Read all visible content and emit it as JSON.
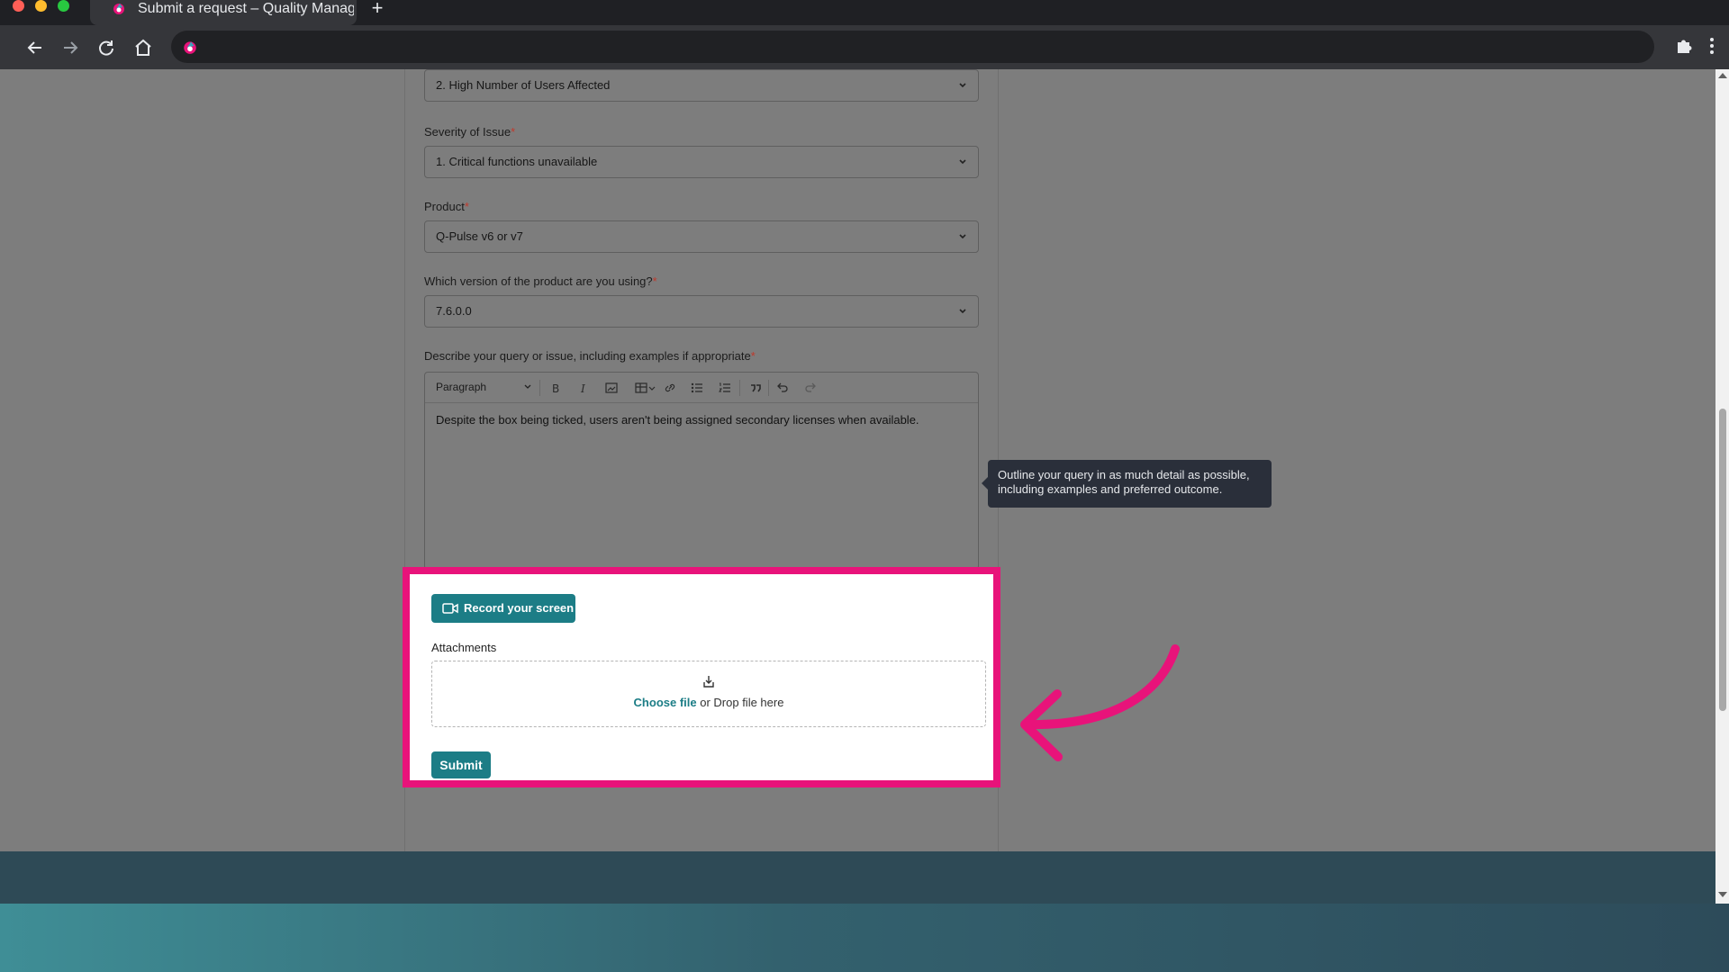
{
  "browser": {
    "tab_title": "Submit a request – Quality Manag",
    "new_tab_label": "+"
  },
  "form": {
    "fields": [
      {
        "label": "",
        "required": false,
        "value": "2. High Number of Users Affected"
      },
      {
        "label": "Severity of Issue",
        "required": true,
        "value": "1. Critical functions unavailable"
      },
      {
        "label": "Product",
        "required": true,
        "value": "Q-Pulse v6 or v7"
      },
      {
        "label": "Which version of the product are you using?",
        "required": true,
        "value": "7.6.0.0"
      }
    ],
    "description": {
      "label": "Describe your query or issue, including examples if appropriate",
      "required_mark": "*",
      "paragraph_style": "Paragraph",
      "text": "Despite the box being ticked, users aren't being assigned secondary licenses when available."
    },
    "tooltip": "Outline your query in as much detail as possible, including examples and preferred outcome.",
    "record_button": "Record your screen",
    "attachments_label": "Attachments",
    "dropzone": {
      "link": "Choose file",
      "text": " or Drop file here"
    },
    "submit_button": "Submit"
  },
  "colors": {
    "accent": "#1c7d86",
    "highlight": "#e8137a",
    "overlay": "#7d7d7d",
    "footer": "#141821"
  },
  "icons": {
    "toolbar": [
      "bold-icon",
      "italic-icon",
      "image-icon",
      "table-icon",
      "link-icon",
      "bulleted-list-icon",
      "numbered-list-icon",
      "quote-icon",
      "undo-icon",
      "redo-icon"
    ]
  }
}
